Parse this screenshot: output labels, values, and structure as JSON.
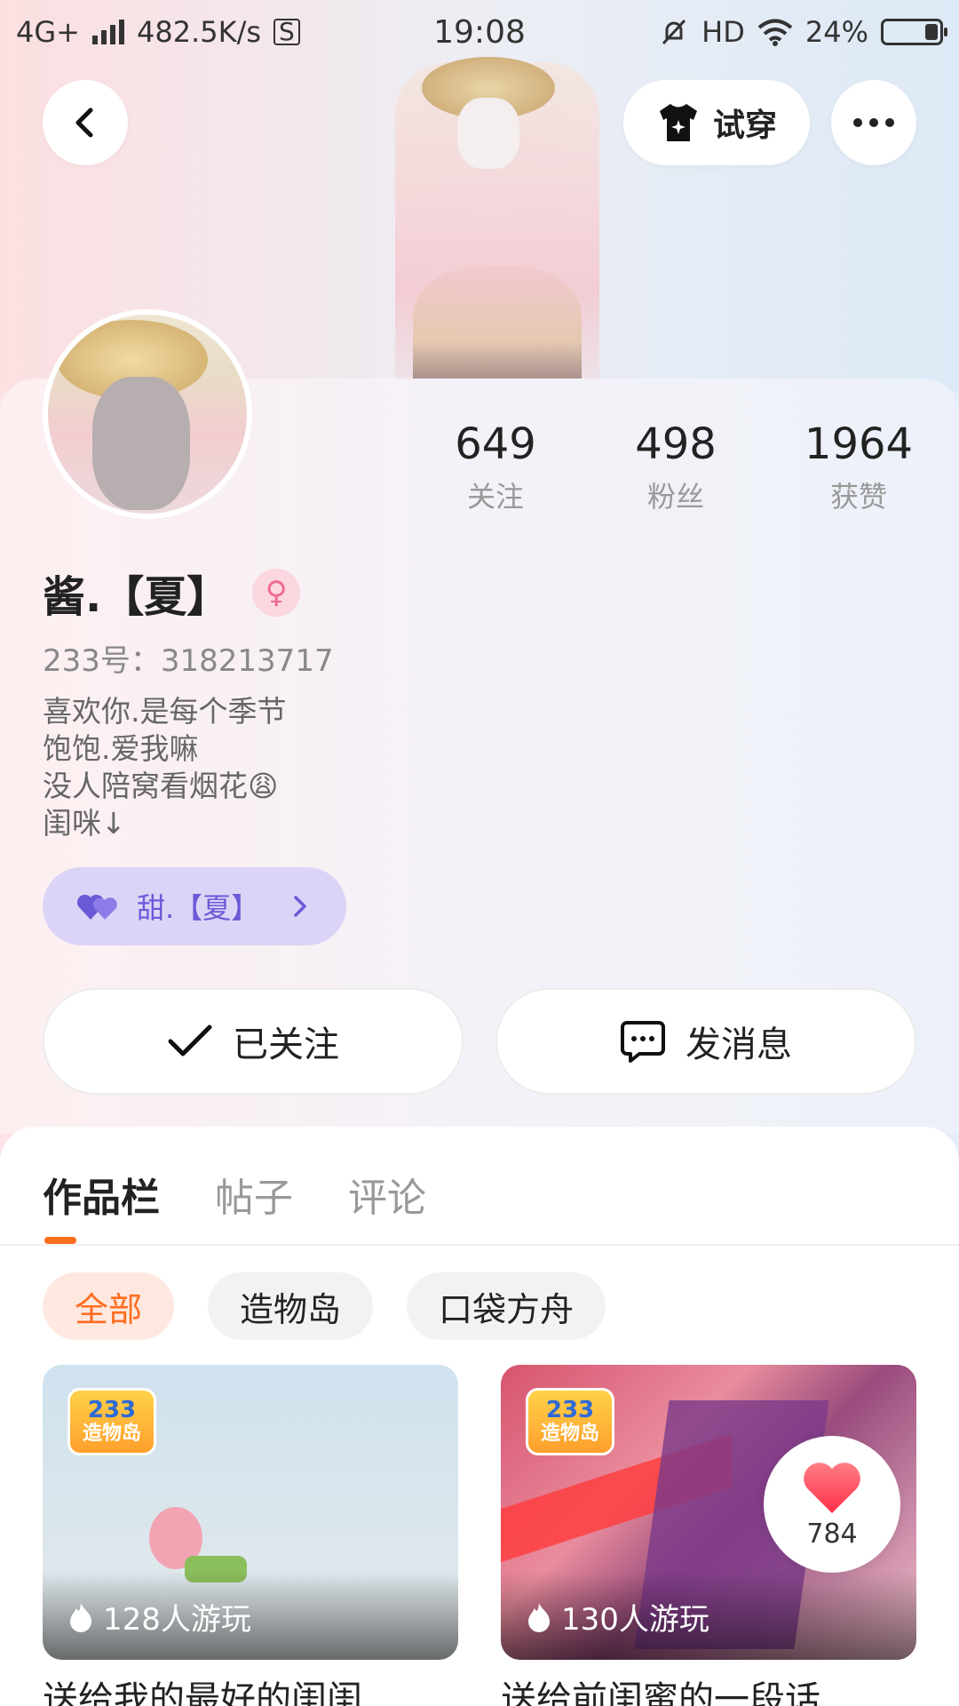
{
  "status_bar": {
    "network": "4G+",
    "speed": "482.5K/s",
    "time": "19:08",
    "hd": "HD",
    "battery": "24%",
    "battery_level": 0.24
  },
  "header": {
    "tryon_label": "试穿"
  },
  "profile": {
    "stats": [
      {
        "value": "649",
        "label": "关注"
      },
      {
        "value": "498",
        "label": "粉丝"
      },
      {
        "value": "1964",
        "label": "获赞"
      }
    ],
    "username": "酱.【夏】",
    "gender_symbol": "♀",
    "uid": "233号：318213717",
    "bio": [
      "喜欢你.是每个季节",
      "饱饱.爱我嘛",
      "没人陪窝看烟花😩",
      "闺咪↓"
    ],
    "cp_tag": "甜.【夏】",
    "follow_label": "已关注",
    "message_label": "发消息"
  },
  "tabs": [
    "作品栏",
    "帖子",
    "评论"
  ],
  "chips": [
    "全部",
    "造物岛",
    "口袋方舟"
  ],
  "cards": [
    {
      "logo_top": "233",
      "logo_bottom": "造物岛",
      "plays": "128人游玩",
      "title": "送给我的最好的闺闺"
    },
    {
      "logo_top": "233",
      "logo_bottom": "造物岛",
      "plays": "130人游玩",
      "title": "送给前闺蜜的一段话",
      "likes": "784"
    }
  ],
  "colors": {
    "accent": "#ff6d1f",
    "cp_text": "#6a5ad8",
    "heart": "#ff4d5e"
  }
}
